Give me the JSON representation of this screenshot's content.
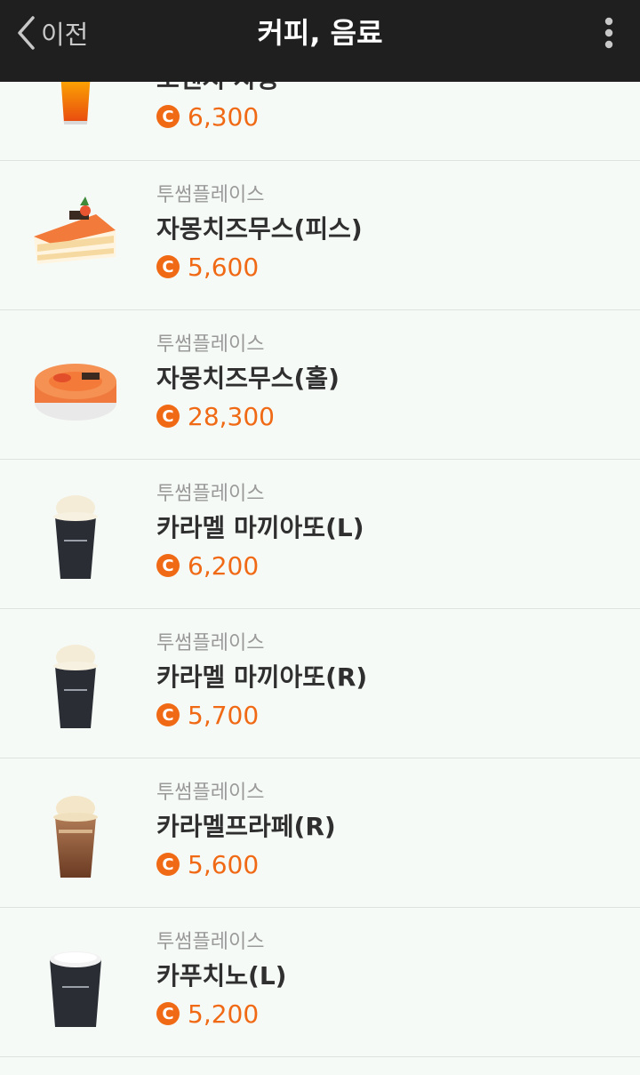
{
  "header": {
    "back_label": "이전",
    "title": "커피, 음료"
  },
  "colors": {
    "accent": "#f06a16",
    "header_bg": "#1f1f1f",
    "page_bg": "#f6faf6"
  },
  "currency_icon": "C",
  "items": [
    {
      "brand": "",
      "name": "오렌지 자몽",
      "price": "6,300",
      "image": "orange-drink-icon"
    },
    {
      "brand": "투썸플레이스",
      "name": "자몽치즈무스(피스)",
      "price": "5,600",
      "image": "cake-slice-icon"
    },
    {
      "brand": "투썸플레이스",
      "name": "자몽치즈무스(홀)",
      "price": "28,300",
      "image": "whole-cake-icon"
    },
    {
      "brand": "투썸플레이스",
      "name": "카라멜 마끼아또(L)",
      "price": "6,200",
      "image": "iced-coffee-cup-icon"
    },
    {
      "brand": "투썸플레이스",
      "name": "카라멜 마끼아또(R)",
      "price": "5,700",
      "image": "iced-coffee-cup-icon"
    },
    {
      "brand": "투썸플레이스",
      "name": "카라멜프라페(R)",
      "price": "5,600",
      "image": "frappe-cup-icon"
    },
    {
      "brand": "투썸플레이스",
      "name": "카푸치노(L)",
      "price": "5,200",
      "image": "hot-coffee-cup-icon"
    }
  ]
}
